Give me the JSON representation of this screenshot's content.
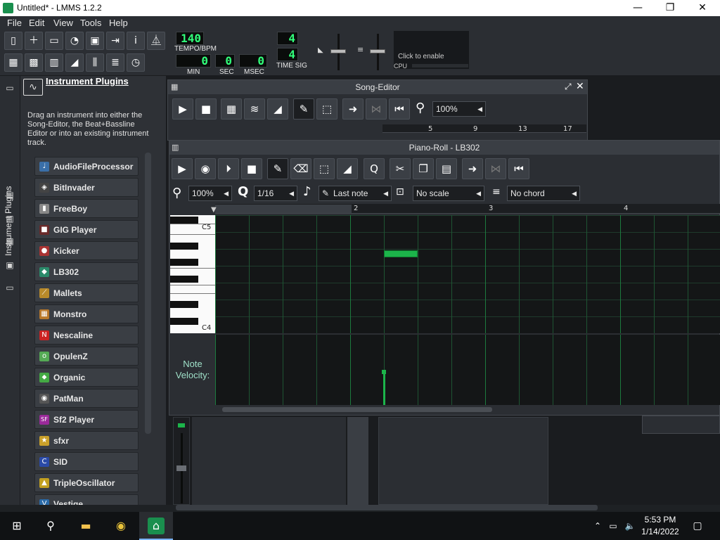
{
  "window": {
    "title": "Untitled* - LMMS 1.2.2",
    "minimize": "—",
    "maximize": "❐",
    "close": "✕"
  },
  "menu": [
    "File",
    "Edit",
    "View",
    "Tools",
    "Help"
  ],
  "transport": {
    "tempo": "140",
    "tempo_label": "TEMPO/BPM",
    "min": "0",
    "sec": "0",
    "msec": "0",
    "min_label": "MIN",
    "sec_label": "SEC",
    "msec_label": "MSEC",
    "timesig_num": "4",
    "timesig_den": "4",
    "timesig_label": "TIME SIG",
    "cpu_hint": "Click to enable",
    "cpu_label": "CPU"
  },
  "sidebar": {
    "tab_label": "Instrument Plugins",
    "panel_title": "Instrument Plugins",
    "description": "Drag an instrument into either the Song-Editor, the Beat+Bassline Editor or into an existing instrument track.",
    "plugins": [
      {
        "name": "AudioFileProcessor",
        "icon": "♩",
        "color": "#3a6fa8"
      },
      {
        "name": "BitInvader",
        "icon": "👾",
        "color": "#444"
      },
      {
        "name": "FreeBoy",
        "icon": "▮",
        "color": "#888"
      },
      {
        "name": "GIG Player",
        "icon": "■",
        "color": "#6a2a2a"
      },
      {
        "name": "Kicker",
        "icon": "●",
        "color": "#a33"
      },
      {
        "name": "LB302",
        "icon": "◆",
        "color": "#2a8a6a"
      },
      {
        "name": "Mallets",
        "icon": "⟋",
        "color": "#b88a2a"
      },
      {
        "name": "Monstro",
        "icon": "▦",
        "color": "#b8782a"
      },
      {
        "name": "Nescaline",
        "icon": "N",
        "color": "#c22"
      },
      {
        "name": "OpulenZ",
        "icon": "o",
        "color": "#5a5"
      },
      {
        "name": "Organic",
        "icon": "⬥",
        "color": "#4a4"
      },
      {
        "name": "PatMan",
        "icon": "◉",
        "color": "#555"
      },
      {
        "name": "Sf2 Player",
        "icon": "SF",
        "color": "#9a2a9a"
      },
      {
        "name": "sfxr",
        "icon": "★",
        "color": "#c9a02a"
      },
      {
        "name": "SID",
        "icon": "C",
        "color": "#2a4aa8"
      },
      {
        "name": "TripleOscillator",
        "icon": "▲",
        "color": "#c2a020"
      },
      {
        "name": "Vestige",
        "icon": "V",
        "color": "#2a6aa8"
      }
    ]
  },
  "song_editor": {
    "title": "Song-Editor",
    "zoom": "100%",
    "ruler": [
      "5",
      "9",
      "13",
      "17"
    ]
  },
  "piano_roll": {
    "title": "Piano-Roll - LB302",
    "zoom": "100%",
    "quantize": "1/16",
    "note_length": "Last note",
    "scale": "No scale",
    "chord": "No chord",
    "ruler": [
      "2",
      "3",
      "4"
    ],
    "keys": [
      "C5",
      "C4"
    ],
    "velocity_label": "Note Velocity:",
    "accent": "#1cb44a"
  },
  "taskbar": {
    "time": "5:53 PM",
    "date": "1/14/2022"
  }
}
